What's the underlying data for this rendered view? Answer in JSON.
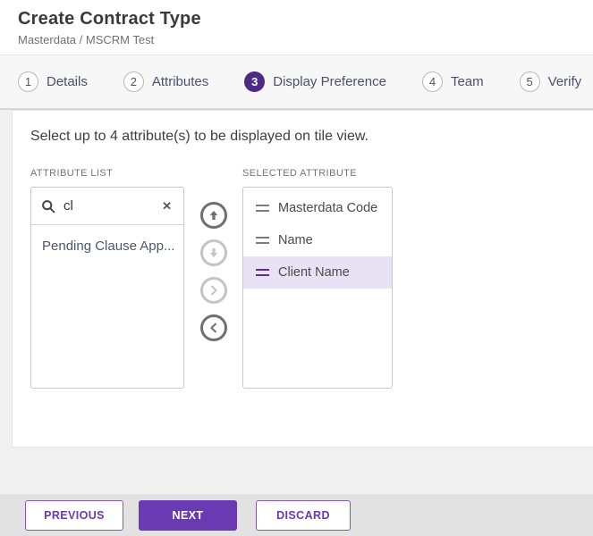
{
  "header": {
    "title": "Create Contract Type",
    "breadcrumb": "Masterdata / MSCRM Test"
  },
  "steps": [
    {
      "num": "1",
      "label": "Details",
      "active": false
    },
    {
      "num": "2",
      "label": "Attributes",
      "active": false
    },
    {
      "num": "3",
      "label": "Display Preference",
      "active": true
    },
    {
      "num": "4",
      "label": "Team",
      "active": false
    },
    {
      "num": "5",
      "label": "Verify",
      "active": false
    }
  ],
  "content": {
    "instruction": "Select up to 4 attribute(s) to be displayed on tile view.",
    "attribute_list": {
      "label": "ATTRIBUTE LIST",
      "search_value": "cl",
      "clear_glyph": "✕",
      "items": [
        "Pending Clause App..."
      ]
    },
    "transfer_buttons": [
      {
        "name": "move-up",
        "enabled": true
      },
      {
        "name": "move-down",
        "enabled": false
      },
      {
        "name": "move-right",
        "enabled": false
      },
      {
        "name": "move-left",
        "enabled": true
      }
    ],
    "selected_attribute": {
      "label": "SELECTED ATTRIBUTE",
      "items": [
        {
          "label": "Masterdata Code",
          "selected": false
        },
        {
          "label": "Name",
          "selected": false
        },
        {
          "label": "Client Name",
          "selected": true
        }
      ]
    }
  },
  "footer": {
    "previous_label": "PREVIOUS",
    "next_label": "NEXT",
    "discard_label": "DISCARD"
  },
  "colors": {
    "accent_purple": "#6a3ab2",
    "step_active_purple": "#4b2b84",
    "selected_row_bg": "#e9e2f4",
    "footer_bar_bg": "#e2e2e2",
    "steps_bar_bg": "#f7f7f7"
  }
}
